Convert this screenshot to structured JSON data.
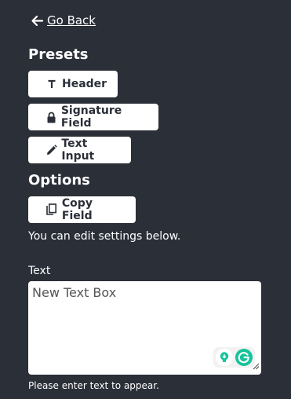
{
  "nav": {
    "back_label": "Go Back"
  },
  "presets": {
    "title": "Presets",
    "items": [
      {
        "label": "Header",
        "icon": "text-t-icon"
      },
      {
        "label": "Signature Field",
        "icon": "lock-icon"
      },
      {
        "label": "Text Input",
        "icon": "pencil-icon"
      }
    ]
  },
  "options": {
    "title": "Options",
    "copy_label": "Copy Field",
    "copy_icon": "copy-icon",
    "helper_text": "You can edit settings below."
  },
  "text_field": {
    "label": "Text",
    "value": "New Text Box",
    "hint": "Please enter text to appear."
  },
  "colors": {
    "background": "#2b2f38",
    "button_bg": "#ffffff",
    "grammarly_green": "#15c39a"
  }
}
